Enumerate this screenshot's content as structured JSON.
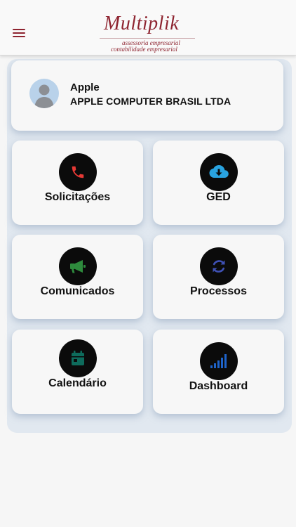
{
  "app": {
    "title": "Multiplik",
    "subtitle_line1": "assessoria empresarial",
    "subtitle_line2": "contabilidade empresarial",
    "brand_color": "#8e2430"
  },
  "header": {
    "menu_icon": "hamburger-menu-icon"
  },
  "user": {
    "name": "Apple",
    "company": "APPLE COMPUTER BRASIL LTDA",
    "avatar_icon": "user-avatar-icon"
  },
  "tiles": [
    {
      "label": "Solicitações",
      "icon": "phone-icon",
      "icon_color": "#e53935"
    },
    {
      "label": "GED",
      "icon": "cloud-download-icon",
      "icon_color": "#29a3e0"
    },
    {
      "label": "Comunicados",
      "icon": "megaphone-icon",
      "icon_color": "#2e8b3d"
    },
    {
      "label": "Processos",
      "icon": "sync-icon",
      "icon_color": "#3f51b5"
    },
    {
      "label": "Calendário",
      "icon": "calendar-icon",
      "icon_color": "#0e6b5c"
    },
    {
      "label": "Dashboard",
      "icon": "signal-bars-icon",
      "icon_color": "#1e63c9"
    }
  ]
}
